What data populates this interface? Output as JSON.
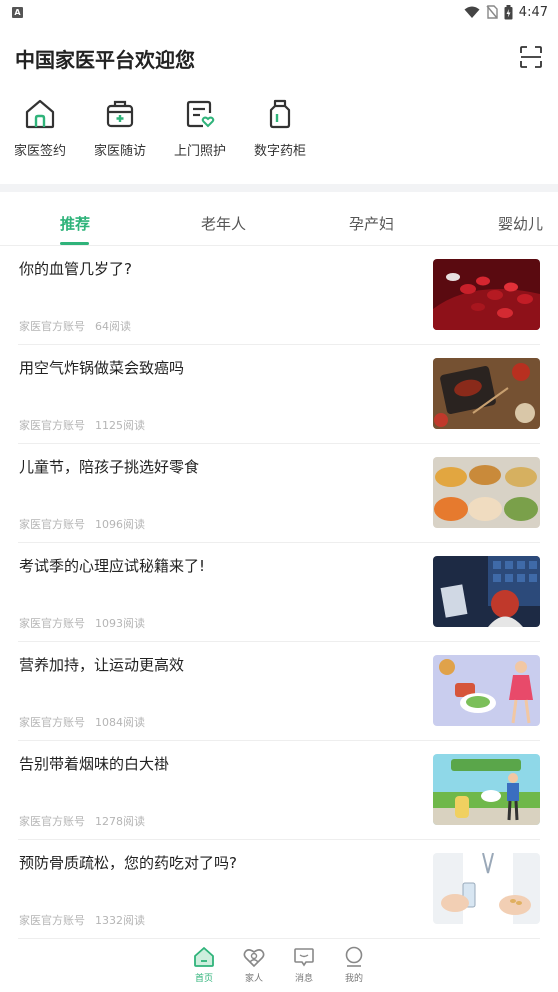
{
  "status_bar": {
    "time": "4:47",
    "notification_icon": "app-a-icon",
    "icons": [
      "wifi-icon",
      "no-sim-icon",
      "battery-icon"
    ]
  },
  "header": {
    "title": "中国家医平台欢迎您",
    "scan_icon": "scan-icon"
  },
  "quick_actions": [
    {
      "label": "家医签约",
      "icon": "house-icon"
    },
    {
      "label": "家医随访",
      "icon": "medical-kit-icon"
    },
    {
      "label": "上门照护",
      "icon": "care-card-icon"
    },
    {
      "label": "数字药柜",
      "icon": "medicine-bottle-icon"
    }
  ],
  "tabs": [
    {
      "label": "推荐",
      "active": true
    },
    {
      "label": "老年人",
      "active": false
    },
    {
      "label": "孕产妇",
      "active": false
    },
    {
      "label": "婴幼儿",
      "active": false
    }
  ],
  "articles": [
    {
      "title": "你的血管几岁了?",
      "source": "家医官方账号",
      "reads": "64阅读",
      "thumb": "blood-cells-image"
    },
    {
      "title": "用空气炸锅做菜会致癌吗",
      "source": "家医官方账号",
      "reads": "1125阅读",
      "thumb": "grill-food-image"
    },
    {
      "title": "儿童节，陪孩子挑选好零食",
      "source": "家医官方账号",
      "reads": "1096阅读",
      "thumb": "snacks-image"
    },
    {
      "title": "考试季的心理应试秘籍来了!",
      "source": "家医官方账号",
      "reads": "1093阅读",
      "thumb": "student-study-image"
    },
    {
      "title": "营养加持，让运动更高效",
      "source": "家医官方账号",
      "reads": "1084阅读",
      "thumb": "nutrition-sport-image"
    },
    {
      "title": "告别带着烟味的白大褂",
      "source": "家医官方账号",
      "reads": "1278阅读",
      "thumb": "no-smoking-image"
    },
    {
      "title": "预防骨质疏松，您的药吃对了吗?",
      "source": "家医官方账号",
      "reads": "1332阅读",
      "thumb": "doctor-pills-image"
    }
  ],
  "bottom_nav": [
    {
      "label": "首页",
      "icon": "home-icon",
      "active": true
    },
    {
      "label": "家人",
      "icon": "family-icon",
      "active": false
    },
    {
      "label": "消息",
      "icon": "message-icon",
      "active": false
    },
    {
      "label": "我的",
      "icon": "profile-icon",
      "active": false
    }
  ],
  "colors": {
    "accent": "#2fb37a",
    "text": "#222222",
    "meta": "#b5b5b5"
  }
}
